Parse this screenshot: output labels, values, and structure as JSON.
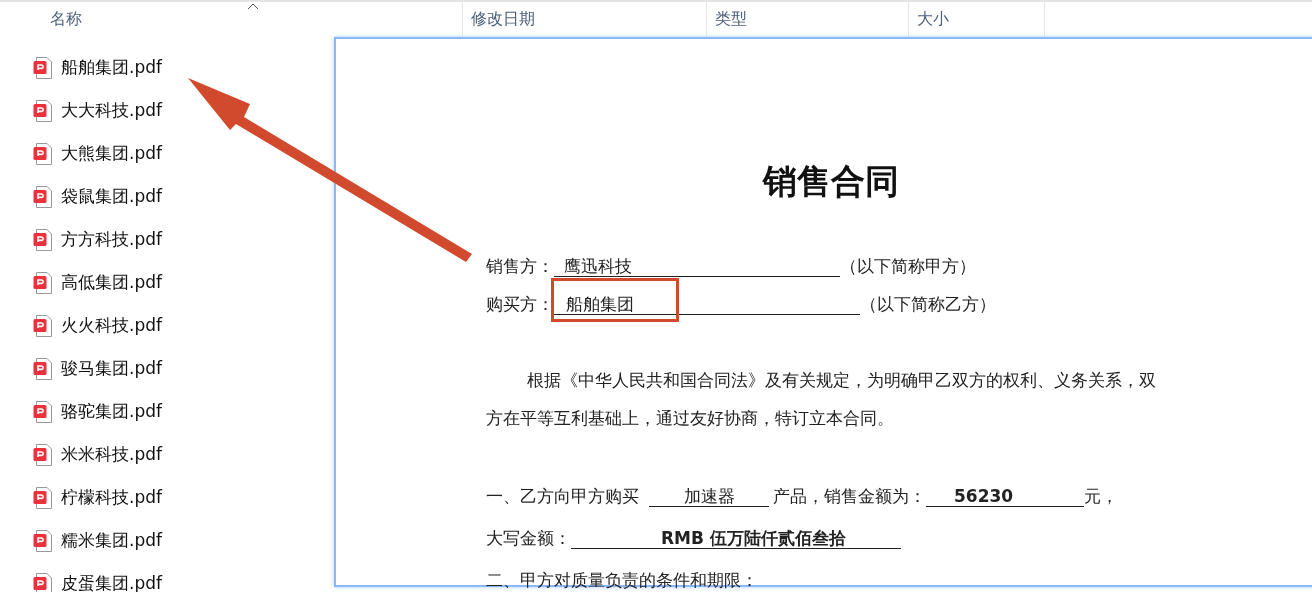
{
  "columns": [
    {
      "label": "名称"
    },
    {
      "label": "修改日期"
    },
    {
      "label": "类型"
    },
    {
      "label": "大小"
    }
  ],
  "files": [
    {
      "name": "船舶集团.pdf"
    },
    {
      "name": "大大科技.pdf"
    },
    {
      "name": "大熊集团.pdf"
    },
    {
      "name": "袋鼠集团.pdf"
    },
    {
      "name": "方方科技.pdf"
    },
    {
      "name": "高低集团.pdf"
    },
    {
      "name": "火火科技.pdf"
    },
    {
      "name": "骏马集团.pdf"
    },
    {
      "name": "骆驼集团.pdf"
    },
    {
      "name": "米米科技.pdf"
    },
    {
      "name": "柠檬科技.pdf"
    },
    {
      "name": "糯米集团.pdf"
    },
    {
      "name": "皮蛋集团.pdf"
    }
  ],
  "document": {
    "title": "销售合同",
    "seller": {
      "label": "销售方：",
      "value": "鹰迅科技",
      "note": "（以下简称甲方）"
    },
    "buyer": {
      "label": "购买方：",
      "value": "船舶集团",
      "note": "（以下简称乙方）"
    },
    "paragraph": "根据《中华人民共和国合同法》及有关规定，为明确甲乙双方的权利、义务关系，双方在平等互利基础上，通过友好协商，特订立本合同。",
    "clause_1": {
      "prefix": "一、乙方向甲方购买",
      "product": "加速器",
      "middle": "产品，销售金额为：",
      "amount": "56230",
      "suffix": "元，"
    },
    "amount_words": {
      "label": "大写金额：",
      "value": "RMB 伍万陆仟贰佰叁拾"
    },
    "clause_2": "二、甲方对质量负责的条件和期限："
  }
}
